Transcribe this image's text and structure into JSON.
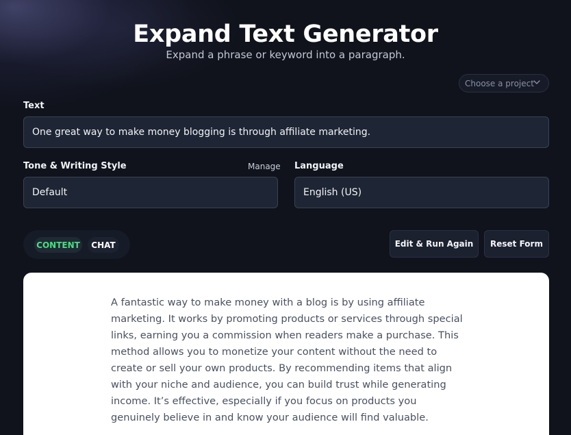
{
  "header": {
    "title": "Expand Text Generator",
    "subtitle": "Expand a phrase or keyword into a paragraph."
  },
  "project_select": {
    "value": "Choose a project",
    "icon": "chevron-down-icon"
  },
  "form": {
    "text_label": "Text",
    "text_value": "One great way to make money blogging is through affiliate marketing.",
    "tone_label": "Tone & Writing Style",
    "manage_label": "Manage",
    "tone_value": "Default",
    "language_label": "Language",
    "language_value": "English (US)"
  },
  "toggles": {
    "content_label": "CONTENT",
    "chat_label": "CHAT",
    "active": "CONTENT"
  },
  "actions": {
    "edit_run_label": "Edit & Run Again",
    "reset_label": "Reset Form"
  },
  "result": {
    "text": "A fantastic way to make money with a blog is by using affiliate marketing. It works by promoting products or services through special links, earning you a commission when readers make a purchase. This method allows you to monetize your content without the need to create or sell your own products. By recommending items that align with your niche and audience, you can build trust while generating income. It’s effective, especially if you focus on products you genuinely believe in and know your audience will find valuable."
  },
  "colors": {
    "background": "#10131c",
    "field_bg": "#1e2534",
    "accent_green": "#4ade80"
  }
}
